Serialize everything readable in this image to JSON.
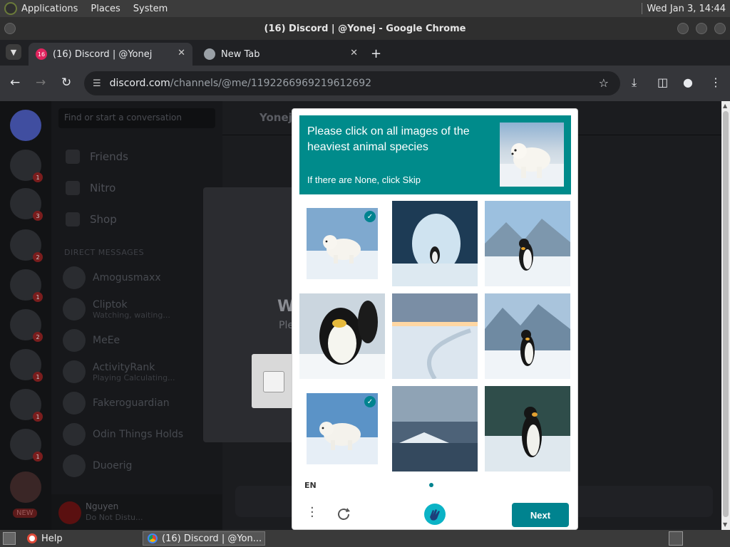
{
  "panel": {
    "menus": [
      "Applications",
      "Places",
      "System"
    ],
    "clock": "Wed Jan  3, 14:44"
  },
  "window": {
    "title": "(16) Discord | @Yonej - Google Chrome"
  },
  "tabs": [
    {
      "label": "(16) Discord | @Yonej",
      "badge": "16"
    },
    {
      "label": "New Tab"
    }
  ],
  "address": {
    "host": "discord.com",
    "path": "/channels/@me/1192266969219612692"
  },
  "discord": {
    "search_placeholder": "Find or start a conversation",
    "nav": [
      "Friends",
      "Nitro",
      "Shop"
    ],
    "dm_header": "DIRECT MESSAGES",
    "dms": [
      {
        "name": "Amogusmaxx",
        "sub": ""
      },
      {
        "name": "Cliptok",
        "sub": "Watching, waiting..."
      },
      {
        "name": "MeEe",
        "sub": ""
      },
      {
        "name": "ActivityRank",
        "sub": "Playing Calculating..."
      },
      {
        "name": "Fakeroguardian",
        "sub": ""
      },
      {
        "name": "Odin Things Holds",
        "sub": ""
      },
      {
        "name": "Duoerig",
        "sub": ""
      }
    ],
    "user": {
      "name": "Nguyen",
      "status": "Do Not Distu..."
    },
    "header_name": "Yonej",
    "verify": {
      "title": "W",
      "subtitle": "Ple"
    },
    "server_badges": [
      "1",
      "3",
      "2",
      "1",
      "2",
      "1",
      "1",
      "1"
    ],
    "new_badge": "NEW"
  },
  "captcha": {
    "prompt": "Please click on all images of the heaviest animal species",
    "hint": "If there are None, click Skip",
    "language": "EN",
    "next_label": "Next",
    "tiles": [
      {
        "name": "polar-bear-1",
        "selected": true
      },
      {
        "name": "penguin-ice-cave",
        "selected": false
      },
      {
        "name": "penguin-mountains",
        "selected": false
      },
      {
        "name": "penguin-closeup",
        "selected": false
      },
      {
        "name": "snowy-landscape",
        "selected": false
      },
      {
        "name": "penguin-snow",
        "selected": false
      },
      {
        "name": "polar-bear-2",
        "selected": true
      },
      {
        "name": "icy-sea",
        "selected": false
      },
      {
        "name": "penguin-forest",
        "selected": false
      }
    ],
    "accent": "#00838f"
  },
  "taskbar": {
    "items": [
      "Help",
      "(16) Discord | @Yon..."
    ]
  }
}
